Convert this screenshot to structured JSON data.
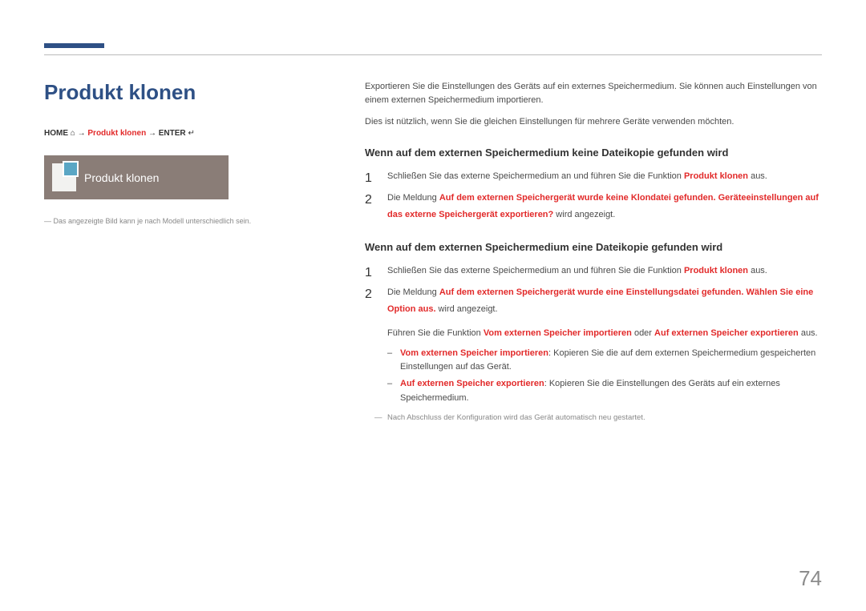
{
  "title": "Produkt klonen",
  "path": {
    "home": "HOME",
    "sep": " → ",
    "mid": "Produkt klonen",
    "enter": "ENTER",
    "home_icon": "⌂",
    "enter_icon": "↵"
  },
  "tile_label": "Produkt klonen",
  "img_note": "Das angezeigte Bild kann je nach Modell unterschiedlich sein.",
  "intro": {
    "p1": "Exportieren Sie die Einstellungen des Geräts auf ein externes Speichermedium. Sie können auch Einstellungen von einem externen Speichermedium importieren.",
    "p2": "Dies ist nützlich, wenn Sie die gleichen Einstellungen für mehrere Geräte verwenden möchten."
  },
  "section_a": {
    "heading": "Wenn auf dem externen Speichermedium keine Dateikopie gefunden wird",
    "step1_pre": "Schließen Sie das externe Speichermedium an und führen Sie die Funktion ",
    "step1_b": "Produkt klonen",
    "step1_post": " aus.",
    "step2_pre": "Die Meldung ",
    "step2_b": "Auf dem externen Speichergerät wurde keine Klondatei gefunden. Geräteeinstellungen auf das externe Speichergerät exportieren?",
    "step2_post": " wird angezeigt."
  },
  "section_b": {
    "heading": "Wenn auf dem externen Speichermedium eine Dateikopie gefunden wird",
    "step1_pre": "Schließen Sie das externe Speichermedium an und führen Sie die Funktion ",
    "step1_b": "Produkt klonen",
    "step1_post": " aus.",
    "step2_pre": "Die Meldung ",
    "step2_b": "Auf dem externen Speichergerät wurde eine Einstellungsdatei gefunden. Wählen Sie eine Option aus.",
    "step2_post": " wird angezeigt.",
    "step2_line2_pre": "Führen Sie die Funktion ",
    "step2_opt_a": "Vom externen Speicher importieren",
    "step2_mid": " oder ",
    "step2_opt_b": "Auf externen Speicher exportieren",
    "step2_end": " aus.",
    "dash_a_b": "Vom externen Speicher importieren",
    "dash_a_t": ": Kopieren Sie die auf dem externen Speichermedium gespeicherten Einstellungen auf das Gerät.",
    "dash_b_b": "Auf externen Speicher exportieren",
    "dash_b_t": ": Kopieren Sie die Einstellungen des Geräts auf ein externes Speichermedium.",
    "footnote": "Nach Abschluss der Konfiguration wird das Gerät automatisch neu gestartet."
  },
  "page_number": "74"
}
